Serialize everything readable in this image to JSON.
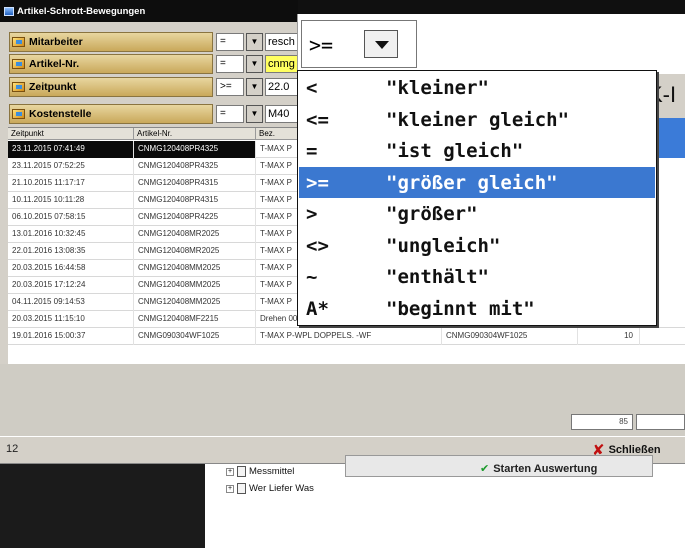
{
  "window": {
    "title": "Artikel-Schrott-Bewegungen"
  },
  "filters": [
    {
      "label": "Mitarbeiter",
      "op": "=",
      "value": "resch",
      "highlight": false
    },
    {
      "label": "Artikel-Nr.",
      "op": "=",
      "value": "cnmg",
      "highlight": true
    },
    {
      "label": "Zeitpunkt",
      "op": ">=",
      "value": "22.0",
      "highlight": false
    },
    {
      "label": "Kostenstelle",
      "op": "=",
      "value": "M40",
      "highlight": false
    }
  ],
  "grid": {
    "columns": [
      "Zeitpunkt",
      "Artikel-Nr.",
      "Bez."
    ],
    "rows": [
      {
        "zeit": "23.11.2015 07:41:49",
        "artikel": "CNMG120408PR4325",
        "bez": "T-MAX P",
        "extra": "",
        "num": ""
      },
      {
        "zeit": "23.11.2015 07:52:25",
        "artikel": "CNMG120408PR4325",
        "bez": "T-MAX P",
        "extra": "",
        "num": ""
      },
      {
        "zeit": "21.10.2015 11:17:17",
        "artikel": "CNMG120408PR4315",
        "bez": "T-MAX P",
        "extra": "",
        "num": ""
      },
      {
        "zeit": "10.11.2015 10:11:28",
        "artikel": "CNMG120408PR4315",
        "bez": "T-MAX P",
        "extra": "",
        "num": ""
      },
      {
        "zeit": "06.10.2015 07:58:15",
        "artikel": "CNMG120408PR4225",
        "bez": "T-MAX P",
        "extra": "",
        "num": ""
      },
      {
        "zeit": "13.01.2016 10:32:45",
        "artikel": "CNMG120408MR2025",
        "bez": "T-MAX P",
        "extra": "",
        "num": ""
      },
      {
        "zeit": "22.01.2016 13:08:35",
        "artikel": "CNMG120408MR2025",
        "bez": "T-MAX P",
        "extra": "",
        "num": ""
      },
      {
        "zeit": "20.03.2015 16:44:58",
        "artikel": "CNMG120408MM2025",
        "bez": "T-MAX P",
        "extra": "",
        "num": ""
      },
      {
        "zeit": "20.03.2015 17:12:24",
        "artikel": "CNMG120408MM2025",
        "bez": "T-MAX P",
        "extra": "",
        "num": ""
      },
      {
        "zeit": "04.11.2015 09:14:53",
        "artikel": "CNMG120408MM2025",
        "bez": "T-MAX P",
        "extra": "",
        "num": ""
      },
      {
        "zeit": "20.03.2015 11:15:10",
        "artikel": "CNMG120408MF2215",
        "bez": "Drehen 00°",
        "extra": "CNMG120408MF2225",
        "num": "-1"
      },
      {
        "zeit": "19.01.2016 15:00:37",
        "artikel": "CNMG090304WF1025",
        "bez": "T-MAX P-WPL DOPPELS. -WF",
        "extra": "CNMG090304WF1025",
        "num": "10"
      }
    ]
  },
  "footer": {
    "count": "85",
    "page_number": "12",
    "close_label": "Schließen"
  },
  "dropdown": {
    "current": ">=",
    "header_fragment": "K-I",
    "options": [
      {
        "symbol": "<",
        "label": "\"kleiner\""
      },
      {
        "symbol": "<=",
        "label": "\"kleiner gleich\""
      },
      {
        "symbol": "=",
        "label": "\"ist gleich\""
      },
      {
        "symbol": ">=",
        "label": "\"größer gleich\""
      },
      {
        "symbol": ">",
        "label": "\"größer\""
      },
      {
        "symbol": "<>",
        "label": "\"ungleich\""
      },
      {
        "symbol": "~",
        "label": "\"enthält\""
      },
      {
        "symbol": "A*",
        "label": "\"beginnt mit\""
      }
    ],
    "selected_index": 3
  },
  "background": {
    "tree_items": [
      "Messmittel",
      "Wer Liefer Was"
    ],
    "start_button": "Starten Auswertung"
  },
  "colors": {
    "selection": "#3b78d0",
    "label_gold": "#c9a85a",
    "highlight_yellow": "#ffff60",
    "close_red": "#c01010"
  }
}
